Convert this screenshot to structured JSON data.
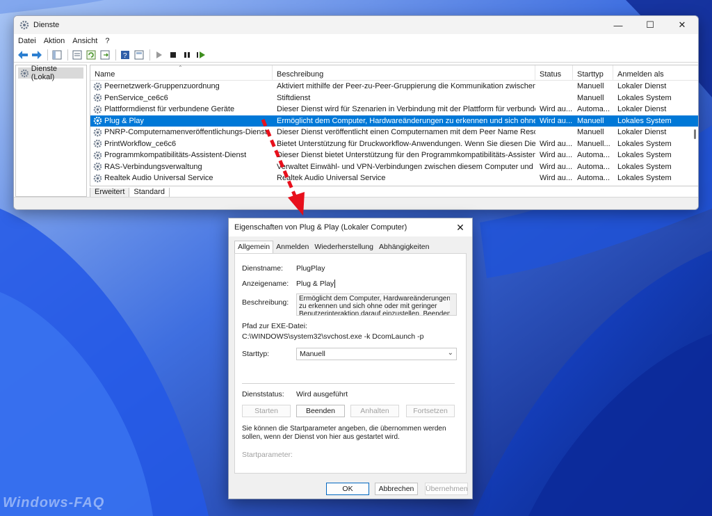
{
  "colors": {
    "accent": "#0078d7",
    "arrow": "#e8101c",
    "wallpaper": "#0b2a8a"
  },
  "watermark": "Windows-FAQ",
  "services_window": {
    "title": "Dienste",
    "icon": "gears-icon",
    "menu": [
      "Datei",
      "Aktion",
      "Ansicht",
      "?"
    ],
    "tree_item": "Dienste (Lokal)",
    "columns": [
      "Name",
      "Beschreibung",
      "Status",
      "Starttyp",
      "Anmelden als"
    ],
    "rows": [
      {
        "name": "Peernetzwerk-Gruppenzuordnung",
        "desc": "Aktiviert mithilfe der Peer-zu-Peer-Gruppierung die Kommunikation zwischen ...",
        "status": "",
        "start": "Manuell",
        "as": "Lokaler Dienst"
      },
      {
        "name": "PenService_ce6c6",
        "desc": "Stiftdienst",
        "status": "",
        "start": "Manuell",
        "as": "Lokales System"
      },
      {
        "name": "Plattformdienst für verbundene Geräte",
        "desc": "Dieser Dienst wird für Szenarien in Verbindung mit der Plattform für verbunden...",
        "status": "Wird au...",
        "start": "Automa...",
        "as": "Lokaler Dienst"
      },
      {
        "name": "Plug & Play",
        "desc": "Ermöglicht dem Computer, Hardwareänderungen zu erkennen und sich ohne ...",
        "status": "Wird au...",
        "start": "Manuell",
        "as": "Lokales System",
        "selected": true
      },
      {
        "name": "PNRP-Computernamenveröffentlichungs-Dienst",
        "desc": "Dieser Dienst veröffentlicht einen Computernamen mit dem Peer Name Resol...",
        "status": "",
        "start": "Manuell",
        "as": "Lokaler Dienst"
      },
      {
        "name": "PrintWorkflow_ce6c6",
        "desc": "Bietet Unterstützung für Druckworkflow-Anwendungen. Wenn Sie diesen Dien...",
        "status": "Wird au...",
        "start": "Manuell...",
        "as": "Lokales System"
      },
      {
        "name": "Programmkompatibilitäts-Assistent-Dienst",
        "desc": "Dieser Dienst bietet Unterstützung für den Programmkompatibilitäts-Assistent...",
        "status": "Wird au...",
        "start": "Automa...",
        "as": "Lokales System"
      },
      {
        "name": "RAS-Verbindungsverwaltung",
        "desc": "Verwaltet Einwähl- und VPN-Verbindungen zwischen diesem Computer und d...",
        "status": "Wird au...",
        "start": "Automa...",
        "as": "Lokales System"
      },
      {
        "name": "Realtek Audio Universal Service",
        "desc": "Realtek Audio Universal Service",
        "status": "Wird au...",
        "start": "Automa...",
        "as": "Lokales System"
      }
    ],
    "bottom_tabs": [
      "Erweitert",
      "Standard"
    ]
  },
  "dialog": {
    "title": "Eigenschaften von Plug & Play (Lokaler Computer)",
    "tabs": [
      "Allgemein",
      "Anmelden",
      "Wiederherstellung",
      "Abhängigkeiten"
    ],
    "dienstname_label": "Dienstname:",
    "dienstname": "PlugPlay",
    "anzeigename_label": "Anzeigename:",
    "anzeigename": "Plug & Play",
    "beschreibung_label": "Beschreibung:",
    "beschreibung": "Ermöglicht dem Computer, Hardwareänderungen zu erkennen und sich ohne oder mit geringer Benutzerinteraktion darauf einzustellen. Beenden",
    "pfad_label": "Pfad zur EXE-Datei:",
    "pfad": "C:\\WINDOWS\\system32\\svchost.exe -k DcomLaunch -p",
    "starttyp_label": "Starttyp:",
    "starttyp": "Manuell",
    "dienststatus_label": "Dienststatus:",
    "dienststatus": "Wird ausgeführt",
    "btn_starten": "Starten",
    "btn_beenden": "Beenden",
    "btn_anhalten": "Anhalten",
    "btn_fortsetzen": "Fortsetzen",
    "note": "Sie können die Startparameter angeben, die übernommen werden sollen, wenn der Dienst von hier aus gestartet wird.",
    "startparameter_label": "Startparameter:",
    "btn_ok": "OK",
    "btn_abbrechen": "Abbrechen",
    "btn_uebernehmen": "Übernehmen"
  }
}
